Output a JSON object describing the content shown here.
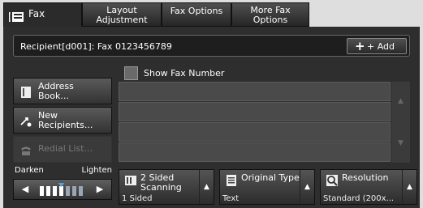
{
  "tabs": [
    {
      "label": "Fax"
    },
    {
      "label_line1": "Layout",
      "label_line2": "Adjustment"
    },
    {
      "label": "Fax Options"
    },
    {
      "label_line1": "More Fax",
      "label_line2": "Options"
    }
  ],
  "recipient": {
    "text": "Recipient[d001]: Fax 0123456789",
    "add_label": "+ Add",
    "add_icon": "plus-icon"
  },
  "show_fax_number": {
    "label": "Show Fax Number",
    "checked": false
  },
  "sidebar": {
    "address_book": {
      "line1": "Address",
      "line2": "Book..."
    },
    "new_recipients": {
      "line1": "New",
      "line2": "Recipients..."
    },
    "redial": {
      "label": "Redial List..."
    }
  },
  "density": {
    "darken_label": "Darken",
    "lighten_label": "Lighten",
    "level_fraction": 0.5
  },
  "functions": {
    "two_sided": {
      "title_line1": "2 Sided",
      "title_line2": "Scanning",
      "value": "1 Sided"
    },
    "original_type": {
      "title": "Original Type",
      "value": "Text"
    },
    "resolution": {
      "title": "Resolution",
      "value": "Standard (200x..."
    }
  }
}
